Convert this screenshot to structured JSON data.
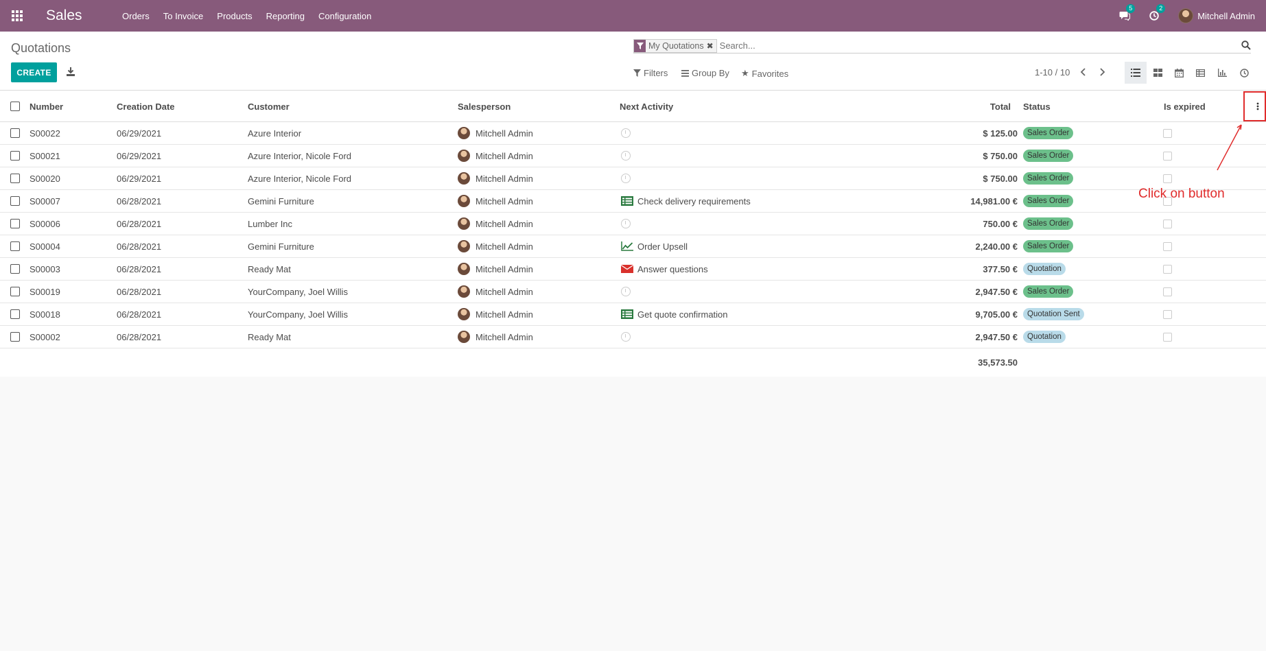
{
  "navbar": {
    "brand": "Sales",
    "menu": [
      "Orders",
      "To Invoice",
      "Products",
      "Reporting",
      "Configuration"
    ],
    "messages_count": "5",
    "activities_count": "2",
    "user_name": "Mitchell Admin"
  },
  "control_panel": {
    "title": "Quotations",
    "create_label": "CREATE",
    "facet_label": "My Quotations",
    "search_placeholder": "Search...",
    "filters_label": "Filters",
    "groupby_label": "Group By",
    "favorites_label": "Favorites",
    "pager": "1-10 / 10"
  },
  "columns": {
    "number": "Number",
    "creation_date": "Creation Date",
    "customer": "Customer",
    "salesperson": "Salesperson",
    "next_activity": "Next Activity",
    "total": "Total",
    "status": "Status",
    "is_expired": "Is expired"
  },
  "rows": [
    {
      "number": "S00022",
      "date": "06/29/2021",
      "customer": "Azure Interior",
      "salesperson": "Mitchell Admin",
      "activity_icon": "clock-icon",
      "activity": "",
      "total": "$ 125.00",
      "status": "Sales Order"
    },
    {
      "number": "S00021",
      "date": "06/29/2021",
      "customer": "Azure Interior, Nicole Ford",
      "salesperson": "Mitchell Admin",
      "activity_icon": "clock-icon",
      "activity": "",
      "total": "$ 750.00",
      "status": "Sales Order"
    },
    {
      "number": "S00020",
      "date": "06/29/2021",
      "customer": "Azure Interior, Nicole Ford",
      "salesperson": "Mitchell Admin",
      "activity_icon": "clock-icon",
      "activity": "",
      "total": "$ 750.00",
      "status": "Sales Order"
    },
    {
      "number": "S00007",
      "date": "06/28/2021",
      "customer": "Gemini Furniture",
      "salesperson": "Mitchell Admin",
      "activity_icon": "list-icon",
      "activity": "Check delivery requirements",
      "total": "14,981.00 €",
      "status": "Sales Order"
    },
    {
      "number": "S00006",
      "date": "06/28/2021",
      "customer": "Lumber Inc",
      "salesperson": "Mitchell Admin",
      "activity_icon": "clock-icon",
      "activity": "",
      "total": "750.00 €",
      "status": "Sales Order"
    },
    {
      "number": "S00004",
      "date": "06/28/2021",
      "customer": "Gemini Furniture",
      "salesperson": "Mitchell Admin",
      "activity_icon": "trend-chart-icon",
      "activity": "Order Upsell",
      "total": "2,240.00 €",
      "status": "Sales Order"
    },
    {
      "number": "S00003",
      "date": "06/28/2021",
      "customer": "Ready Mat",
      "salesperson": "Mitchell Admin",
      "activity_icon": "envelope-icon",
      "activity": "Answer questions",
      "total": "377.50 €",
      "status": "Quotation"
    },
    {
      "number": "S00019",
      "date": "06/28/2021",
      "customer": "YourCompany, Joel Willis",
      "salesperson": "Mitchell Admin",
      "activity_icon": "clock-icon",
      "activity": "",
      "total": "2,947.50 €",
      "status": "Sales Order"
    },
    {
      "number": "S00018",
      "date": "06/28/2021",
      "customer": "YourCompany, Joel Willis",
      "salesperson": "Mitchell Admin",
      "activity_icon": "list-icon",
      "activity": "Get quote confirmation",
      "total": "9,705.00 €",
      "status": "Quotation Sent"
    },
    {
      "number": "S00002",
      "date": "06/28/2021",
      "customer": "Ready Mat",
      "salesperson": "Mitchell Admin",
      "activity_icon": "clock-icon",
      "activity": "",
      "total": "2,947.50 €",
      "status": "Quotation"
    }
  ],
  "grand_total": "35,573.50",
  "status_colors": {
    "Sales Order": "#6cc08b",
    "Quotation": "#b9dbe9",
    "Quotation Sent": "#b9dbe9"
  },
  "annotation": {
    "text": "Click on button",
    "color": "#e02b2b"
  }
}
